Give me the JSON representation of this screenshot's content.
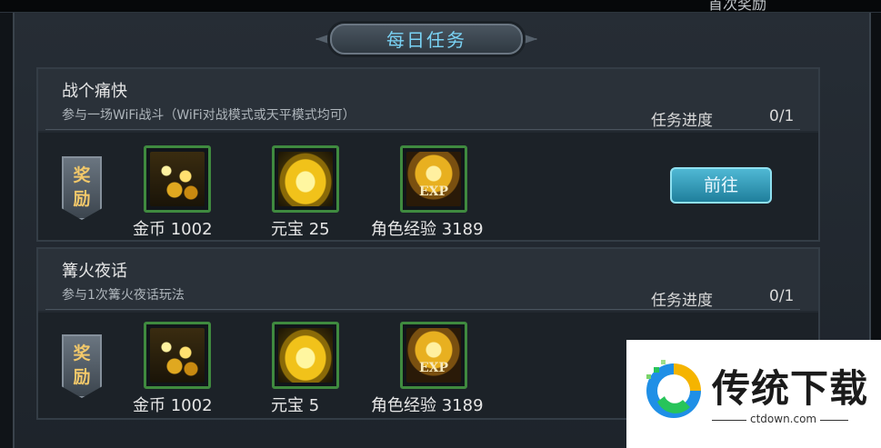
{
  "top_hint": "首次奖励",
  "title": "每日任务",
  "progress_label": "任务进度",
  "reward_tag": [
    "奖",
    "励"
  ],
  "tasks": [
    {
      "name": "战个痛快",
      "desc": "参与一场WiFi战斗（WiFi对战模式或天平模式均可）",
      "progress": "0/1",
      "rewards": [
        {
          "icon": "gold-coins-icon",
          "label": "金币 1002"
        },
        {
          "icon": "ingot-icon",
          "label": "元宝 25"
        },
        {
          "icon": "exp-icon",
          "label": "角色经验 3189"
        }
      ],
      "button": "前往"
    },
    {
      "name": "篝火夜话",
      "desc": "参与1次篝火夜话玩法",
      "progress": "0/1",
      "rewards": [
        {
          "icon": "gold-coins-icon",
          "label": "金币 1002"
        },
        {
          "icon": "ingot-icon",
          "label": "元宝 5"
        },
        {
          "icon": "exp-icon",
          "label": "角色经验 3189"
        }
      ]
    }
  ],
  "exp_icon_text": "EXP",
  "watermark": {
    "title": "传统下载",
    "url": "ctdown.com"
  }
}
